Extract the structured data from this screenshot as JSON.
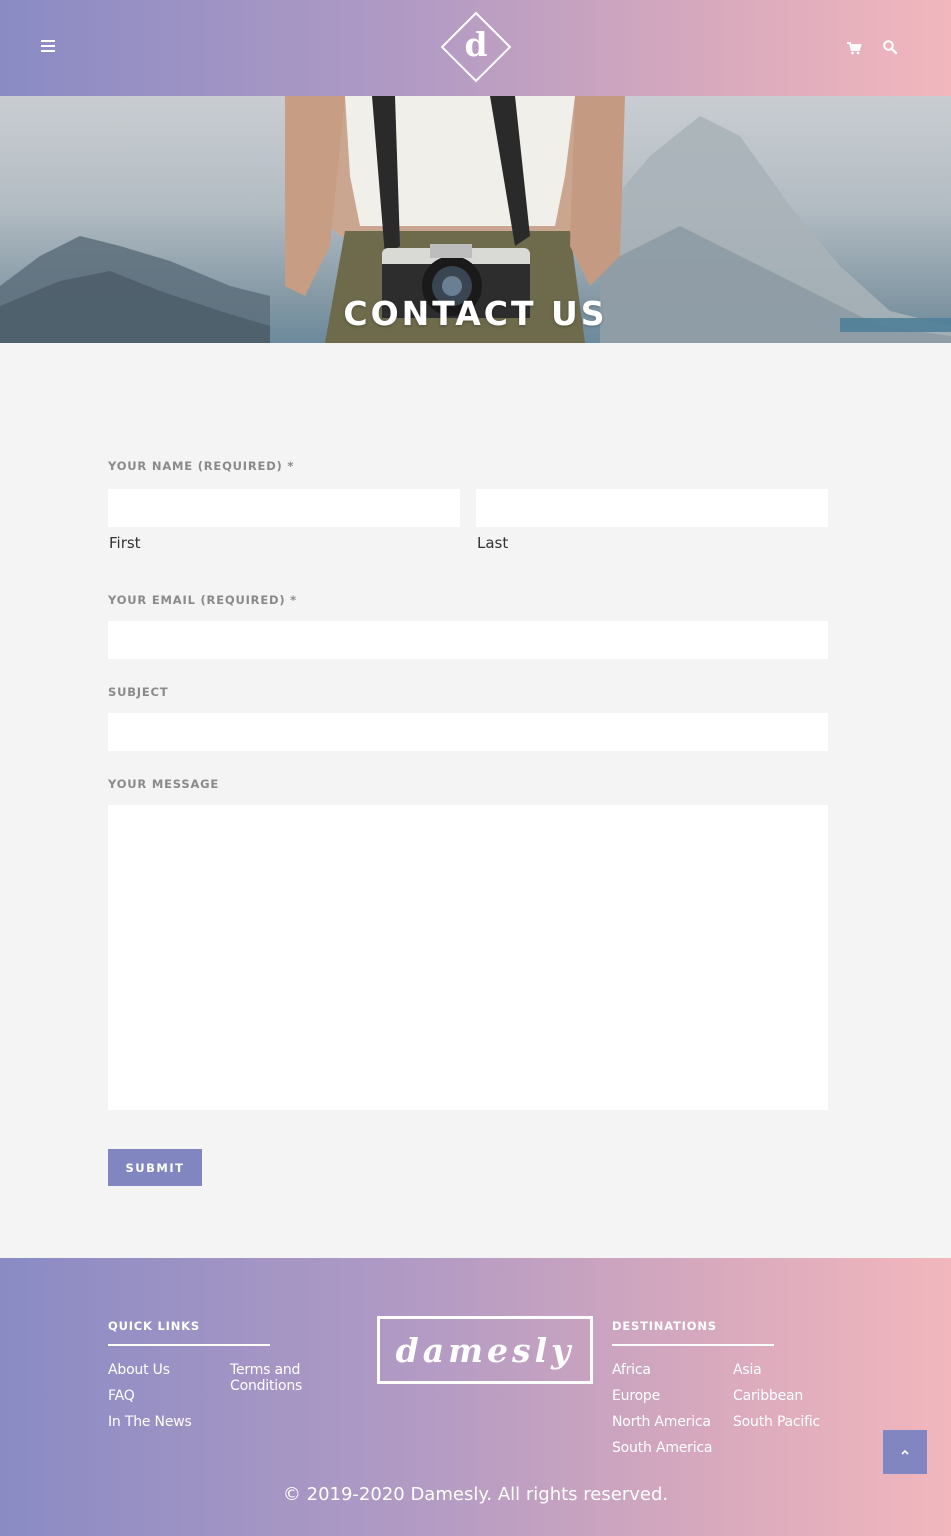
{
  "header": {
    "logo_letter": "d"
  },
  "hero": {
    "title": "CONTACT US"
  },
  "form": {
    "name_label": "YOUR NAME (REQUIRED) *",
    "first_sublabel": "First",
    "last_sublabel": "Last",
    "first_value": "",
    "last_value": "",
    "email_label": "YOUR EMAIL (REQUIRED) *",
    "email_value": "",
    "subject_label": "SUBJECT",
    "subject_value": "",
    "message_label": "YOUR MESSAGE",
    "message_value": "",
    "submit_label": "SUBMIT"
  },
  "footer": {
    "quick_links_heading": "QUICK LINKS",
    "quick_links": [
      "About Us",
      "FAQ",
      "In The News",
      "Terms and Conditions"
    ],
    "brand": "damesly",
    "destinations_heading": "DESTINATIONS",
    "destinations": [
      "Africa",
      "Europe",
      "North America",
      "South America",
      "Asia",
      "Caribbean",
      "South Pacific"
    ],
    "copyright": "© 2019-2020 Damesly. All rights reserved."
  },
  "colors": {
    "gradient_start": "#8a8bc4",
    "gradient_end": "#f2b7bd",
    "accent": "#8186c0",
    "page_bg": "#f4f4f4"
  },
  "icons": [
    "hamburger-menu-icon",
    "logo-diamond-icon",
    "cart-icon",
    "search-icon",
    "chevron-up-icon"
  ]
}
